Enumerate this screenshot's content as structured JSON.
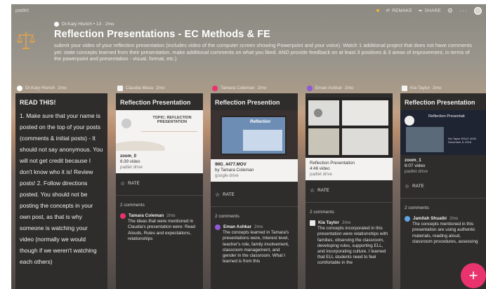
{
  "topbar": {
    "brand": "padlet",
    "remake": "REMAKE",
    "share": "SHARE"
  },
  "header": {
    "meta": "Dr.Katy Hisrich • 13 · 2mo",
    "title": "Reflection Presentations - EC Methods & FE",
    "description": "submit your video of your reflection presentation (includes video of the computer screen showing Powerpoint and your voice). Watch 1 additional project that does not have comments yet: state concepts learned from their presentation. make additional comments on what you liked. AND provide feedback on at least 3 positives & 3 areas of improvement, in terms of the powerpoint and presentation - visual, format, etc.)"
  },
  "columns": [
    {
      "author": "Dr.Katy Hisrich",
      "time": "2mo",
      "title": "READ THIS!",
      "body": "1. Make sure that your name is posted on the top of your posts (comments & initial posts) - It should not say anonymous. You will not get credit because I don't know who it is! Review posts! 2. Follow directions posted. You should not be posting the concepts in your own post, as that is why someone is watching your video (normally we would though if we weren't watching each others)"
    },
    {
      "author": "Claudia Musa",
      "time": "2mo",
      "title": "Reflection Presentation",
      "slide_text": "TOPIC: REFLECTION PRESENTATION",
      "file": "zoom_0",
      "file_sub1": "6:39 video",
      "file_sub2": "padlet drive",
      "rate": "RATE",
      "comments_count": "2 comments",
      "comment_author": "Tamara Coleman",
      "comment_time": "2mo",
      "comment_text": "The ideas that were mentioned in Claudia's presentation were: Read Alouds, Rules and expectations, relationships"
    },
    {
      "author": "Tamara Coleman",
      "time": "2mo",
      "title": "Reflection Presention",
      "slide_text": "Reflection",
      "file": "IMG_4477.MOV",
      "file_sub1": "by Tamara Coleman",
      "file_sub2": "google drive",
      "rate": "RATE",
      "comments_count": "2 comments",
      "comment_author": "Eman Ashkar",
      "comment_time": "2mo",
      "comment_text": "The concepts learned in Tamara's presentations were, Interest level, teacher's role, family involvement, classroom management, and gender in the classroom. What I learned is from this"
    },
    {
      "author": "Eman Ashkar",
      "time": "2mo",
      "file": "Reflection Presentation",
      "file_sub1": "4:46 video",
      "file_sub2": "padlet drive",
      "rate": "RATE",
      "comments_count": "2 comments",
      "comment_author": "Kia Taylor",
      "comment_time": "2mo",
      "comment_text": "The concepts incorporated in this presentation were relationships with families, observing the classroom, developing rules, supporting ELL, and incorporating culture. I learned that ELL students need to feel comfortable in the"
    },
    {
      "author": "Kia Taylor",
      "time": "2mo",
      "title": "Reflection Presentation",
      "slide_text": "Reflection Presentati",
      "slide_sub": "Kia Taylor EDUC 4040 December 8, 2018",
      "file": "zoom_1",
      "file_sub1": "6:07 video",
      "file_sub2": "padlet drive",
      "rate": "RATE",
      "comments_count": "2 comments",
      "comment_author": "Jamilah Shuaibi",
      "comment_time": "2mo",
      "comment_text": "The concepts mentioned in this presentation are using authentic materials, reading aloud, classroom procedures, assessing"
    }
  ],
  "colors": {
    "card": "#2f2d2c",
    "fab": "#e8336e",
    "heart": "#f2b630"
  }
}
